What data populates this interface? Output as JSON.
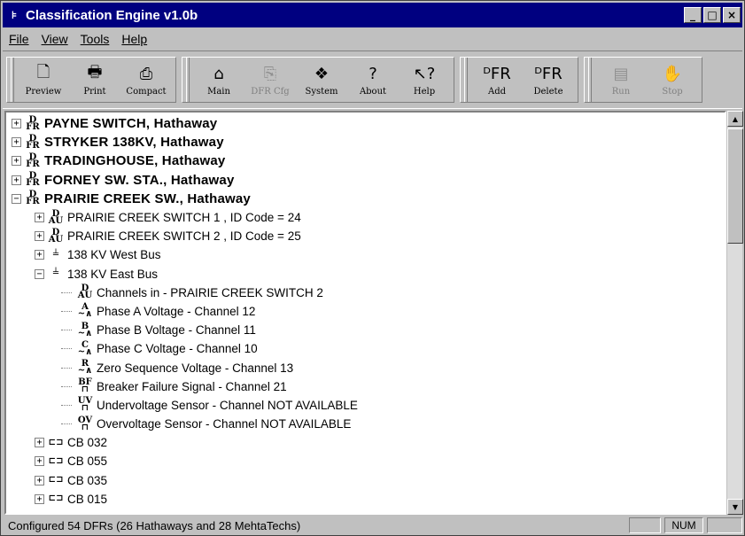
{
  "window": {
    "title": "Classification Engine v1.0b",
    "controls": {
      "minimize": "_",
      "maximize": "□",
      "close": "×"
    }
  },
  "menu": [
    {
      "label": "File",
      "icon": ""
    },
    {
      "label": "View"
    },
    {
      "label": "Tools"
    },
    {
      "label": "Help"
    }
  ],
  "toolbar": {
    "groups": [
      [
        {
          "label": "Preview",
          "icon": "preview-icon",
          "glyph": "🗋",
          "enabled": true
        },
        {
          "label": "Print",
          "icon": "print-icon",
          "glyph": "🖶",
          "enabled": true
        },
        {
          "label": "Compact",
          "icon": "compact-icon",
          "glyph": "⎙",
          "enabled": true
        }
      ],
      [
        {
          "label": "Main",
          "icon": "home-icon",
          "glyph": "⌂",
          "enabled": true
        },
        {
          "label": "DFR Cfg",
          "icon": "dfr-config-icon",
          "glyph": "⎘",
          "enabled": false
        },
        {
          "label": "System",
          "icon": "system-icon",
          "glyph": "❖",
          "enabled": true
        },
        {
          "label": "About",
          "icon": "about-icon",
          "glyph": "?",
          "enabled": true
        },
        {
          "label": "Help",
          "icon": "help-pointer-icon",
          "glyph": "↖?",
          "enabled": true
        }
      ],
      [
        {
          "label": "Add",
          "icon": "add-dfr-icon",
          "glyph": "ᴰFR",
          "enabled": true
        },
        {
          "label": "Delete",
          "icon": "delete-dfr-icon",
          "glyph": "ᴰFR",
          "enabled": true
        }
      ],
      [
        {
          "label": "Run",
          "icon": "run-icon",
          "glyph": "▤",
          "enabled": false
        },
        {
          "label": "Stop",
          "icon": "stop-hand-icon",
          "glyph": "✋",
          "enabled": false
        }
      ]
    ]
  },
  "tree": [
    {
      "level": 0,
      "expander": "+",
      "icon": "dfr",
      "text": "PAYNE SWITCH, Hathaway",
      "bold": true
    },
    {
      "level": 0,
      "expander": "+",
      "icon": "dfr",
      "text": "STRYKER 138KV, Hathaway",
      "bold": true
    },
    {
      "level": 0,
      "expander": "+",
      "icon": "dfr",
      "text": "TRADINGHOUSE, Hathaway",
      "bold": true
    },
    {
      "level": 0,
      "expander": "+",
      "icon": "dfr",
      "text": "FORNEY SW. STA., Hathaway",
      "bold": true
    },
    {
      "level": 0,
      "expander": "−",
      "icon": "dfr",
      "text": "PRAIRIE CREEK SW., Hathaway",
      "bold": true
    },
    {
      "level": 1,
      "expander": "+",
      "icon": "dau",
      "text": "PRAIRIE CREEK SWITCH 1  , ID Code = 24",
      "bold": false
    },
    {
      "level": 1,
      "expander": "+",
      "icon": "dau",
      "text": "PRAIRIE CREEK SWITCH 2  , ID Code = 25",
      "bold": false
    },
    {
      "level": 1,
      "expander": "+",
      "icon": "bus",
      "text": "138 KV West Bus",
      "bold": false
    },
    {
      "level": 1,
      "expander": "−",
      "icon": "bus",
      "text": "138 KV East Bus",
      "bold": false
    },
    {
      "level": 2,
      "expander": "",
      "icon": "dau",
      "text": "Channels in - PRAIRIE CREEK SWITCH 2",
      "bold": false
    },
    {
      "level": 2,
      "expander": "",
      "icon": "phase-a",
      "text": "Phase A Voltage - Channel 12",
      "bold": false
    },
    {
      "level": 2,
      "expander": "",
      "icon": "phase-b",
      "text": "Phase B Voltage - Channel 11",
      "bold": false
    },
    {
      "level": 2,
      "expander": "",
      "icon": "phase-c",
      "text": "Phase C Voltage - Channel 10",
      "bold": false
    },
    {
      "level": 2,
      "expander": "",
      "icon": "phase-r",
      "text": "Zero Sequence Voltage - Channel 13",
      "bold": false
    },
    {
      "level": 2,
      "expander": "",
      "icon": "bf",
      "text": "Breaker Failure Signal - Channel 21",
      "bold": false
    },
    {
      "level": 2,
      "expander": "",
      "icon": "uv",
      "text": "Undervoltage Sensor - Channel NOT AVAILABLE",
      "bold": false
    },
    {
      "level": 2,
      "expander": "",
      "icon": "ov",
      "text": "Overvoltage Sensor - Channel NOT AVAILABLE",
      "bold": false
    },
    {
      "level": 1,
      "expander": "+",
      "icon": "cb",
      "text": "CB 032",
      "bold": false
    },
    {
      "level": 1,
      "expander": "+",
      "icon": "cb",
      "text": "CB 055",
      "bold": false
    },
    {
      "level": 1,
      "expander": "+",
      "icon": "cb",
      "text": "CB 035",
      "bold": false
    },
    {
      "level": 1,
      "expander": "+",
      "icon": "cb",
      "text": "CB 015",
      "bold": false
    }
  ],
  "icon_glyphs": {
    "dfr": [
      "D",
      "FR"
    ],
    "dau": [
      "D",
      "AU"
    ],
    "bus": [
      "",
      "╧"
    ],
    "phase-a": [
      "A",
      "~∧"
    ],
    "phase-b": [
      "B",
      "~∧"
    ],
    "phase-c": [
      "C",
      "~∧"
    ],
    "phase-r": [
      "R",
      "~∧"
    ],
    "bf": [
      "BF",
      "⊓"
    ],
    "uv": [
      "UV",
      "⊓"
    ],
    "ov": [
      "OV",
      "⊓"
    ],
    "cb": [
      "",
      "⊏⊐"
    ]
  },
  "status": {
    "text": "Configured 54 DFRs (26 Hathaways and 28 MehtaTechs)",
    "panes": [
      "",
      "NUM",
      ""
    ]
  },
  "scrollbar": {
    "up": "▲",
    "down": "▼"
  }
}
